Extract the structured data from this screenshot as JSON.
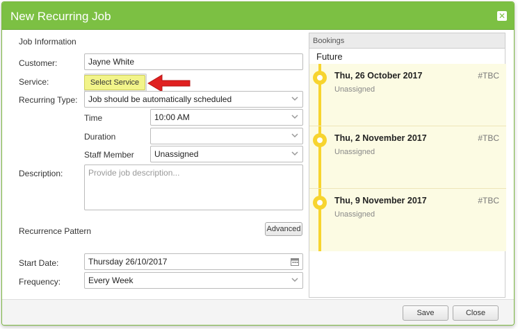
{
  "dialog": {
    "title": "New Recurring Job",
    "close_glyph": "✕"
  },
  "job_info": {
    "section_title": "Job Information",
    "customer_label": "Customer:",
    "customer_value": "Jayne White",
    "service_label": "Service:",
    "service_button": "Select Service",
    "recurring_type_label": "Recurring Type:",
    "recurring_type_value": "Job should be automatically scheduled",
    "time_label": "Time",
    "time_value": "10:00 AM",
    "duration_label": "Duration",
    "duration_value": "",
    "staff_label": "Staff Member",
    "staff_value": "Unassigned",
    "description_label": "Description:",
    "description_placeholder": "Provide job description..."
  },
  "recurrence": {
    "section_title": "Recurrence Pattern",
    "advanced_button": "Advanced",
    "start_date_label": "Start Date:",
    "start_date_value": "Thursday 26/10/2017",
    "frequency_label": "Frequency:",
    "frequency_value": "Every Week"
  },
  "bookings": {
    "header": "Bookings",
    "group": "Future",
    "items": [
      {
        "date": "Thu, 26 October 2017",
        "tag": "#TBC",
        "staff": "Unassigned"
      },
      {
        "date": "Thu, 2 November 2017",
        "tag": "#TBC",
        "staff": "Unassigned"
      },
      {
        "date": "Thu, 9 November 2017",
        "tag": "#TBC",
        "staff": "Unassigned"
      }
    ]
  },
  "footer": {
    "save_button": "Save",
    "close_button": "Close"
  },
  "colors": {
    "title_bar": "#7cc043",
    "timeline": "#f7d42f",
    "booking_bg": "#fcfbe3",
    "service_highlight": "#f2f48a",
    "arrow": "#e02020"
  },
  "icons": [
    "close-icon",
    "chevron-down-icon",
    "calendar-icon",
    "red-arrow-icon",
    "timeline-dot-icon"
  ]
}
